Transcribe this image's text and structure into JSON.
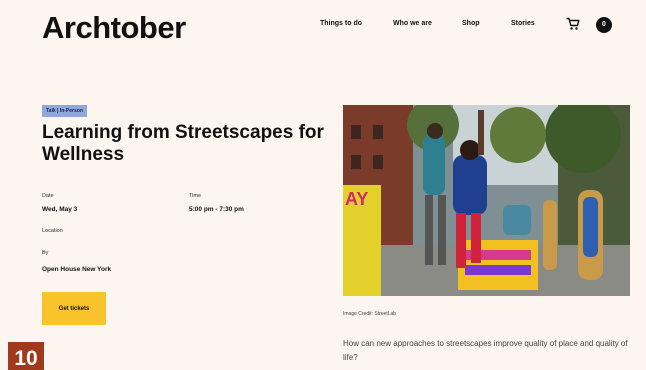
{
  "header": {
    "logo": "Archtober",
    "nav": [
      "Things to do",
      "Who we are",
      "Shop",
      "Stories"
    ],
    "cart_icon": "cart-icon",
    "cart_count": "0"
  },
  "event": {
    "tag": "Talk | In-Person",
    "title": "Learning from Streetscapes for Wellness",
    "date_label": "Date",
    "date_value": "Wed, May 3",
    "time_label": "Time",
    "time_value": "5:00 pm - 7:30 pm",
    "location_label": "Location",
    "by_label": "By",
    "by_value": "Open House New York",
    "cta": "Get tickets"
  },
  "badge": "10",
  "image": {
    "credit": "Image Credit: StreetLab",
    "sign_text": "AY"
  },
  "description": "How can new approaches to streetscapes improve quality of place and quality of life?",
  "colors": {
    "background": "#fdf5ef",
    "tag": "#8fa7d9",
    "cta": "#f9c32c",
    "badge": "#a13a1d"
  }
}
